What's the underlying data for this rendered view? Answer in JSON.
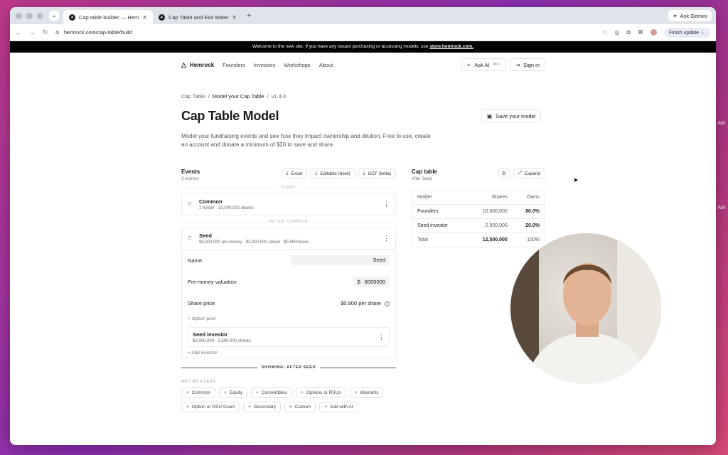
{
  "desktop": {
    "time_1": "AM",
    "time_2": "AM"
  },
  "browser": {
    "tabs": [
      {
        "title": "Cap table builder — Hemrock",
        "active": true
      },
      {
        "title": "Cap Table and Exit Waterfall",
        "active": false
      }
    ],
    "gemini_label": "Ask Gemini",
    "url": "hemrock.com/cap-table/build",
    "finish_update": "Finish update"
  },
  "banner": {
    "text": "Welcome to the new site. If you have any issues purchasing or accessing models, use",
    "link": "store.hemrock.com."
  },
  "nav": {
    "brand": "Hemrock",
    "links": [
      "Founders",
      "Investors",
      "Workshops",
      "About"
    ],
    "ask_ai": "Ask AI",
    "ask_ai_kbd": "⌘K",
    "sign_in": "Sign in"
  },
  "breadcrumb": {
    "root": "Cap Table",
    "current": "Model your Cap Table",
    "version": "v1.4.0"
  },
  "page": {
    "title": "Cap Table Model",
    "save_label": "Save your model",
    "description": "Model your fundraising events and see how they impact ownership and dilution. Free to use, create an account and donate a minimum of $20 to save and share."
  },
  "events": {
    "title": "Events",
    "count": "2 events",
    "actions": [
      "Excel",
      "Editable (beta)",
      "OCF (beta)"
    ],
    "start_label": "START",
    "after_common_label": "AFTER COMMON",
    "common": {
      "name": "Common",
      "meta": "1 holder · 10,000,000 shares"
    },
    "seed": {
      "name": "Seed",
      "meta": "$8,000,000 pre-money · $2,000,000 raised · $0.800/share",
      "name_label": "Name",
      "name_value": "Seed",
      "premoney_label": "Pre-money valuation",
      "currency": "$",
      "premoney_value": "8000000",
      "share_price_label": "Share price",
      "share_price_value": "$0.800 per share",
      "option_pool": "Option pool",
      "investor_name": "Seed investor",
      "investor_meta": "$2,000,000 · 2,500,000 shares",
      "add_investor": "Add investor"
    },
    "showing_label": "SHOWING: AFTER SEED",
    "add_event_label": "ADD AN EVENT",
    "add_event_types": [
      "Common",
      "Equity",
      "Convertibles",
      "Options or RSUs",
      "Warrants",
      "Option or RSU Grant",
      "Secondary",
      "Custom",
      "Add with AI"
    ]
  },
  "cap_table": {
    "title": "Cap table",
    "subtitle": "After Seed",
    "expand_label": "Expand",
    "columns": [
      "Holder",
      "Shares",
      "Owns"
    ],
    "rows": [
      {
        "holder": "Founders",
        "shares": "10,000,000",
        "owns": "80.0%"
      },
      {
        "holder": "Seed investor",
        "shares": "2,500,000",
        "owns": "20.0%"
      }
    ],
    "total": {
      "holder": "Total",
      "shares": "12,500,000",
      "owns": "100%"
    }
  }
}
